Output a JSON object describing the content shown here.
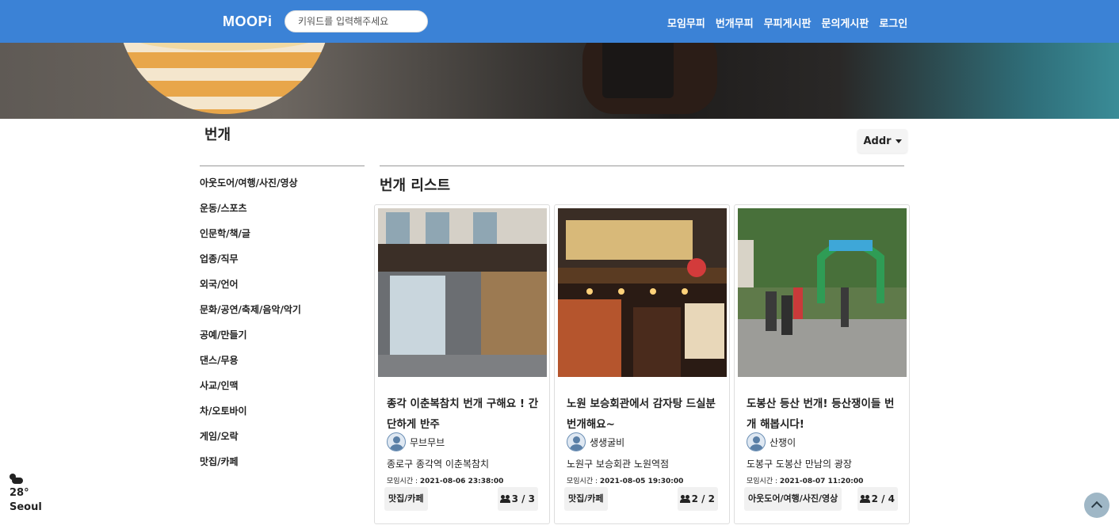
{
  "header": {
    "logo": "MOOPi",
    "search_placeholder": "키워드를 입력해주세요",
    "nav": [
      "모임무피",
      "번개무피",
      "무피게시판",
      "문의게시판",
      "로그인"
    ]
  },
  "page": {
    "title": "번개",
    "addr_button": "Addr",
    "list_title": "번개 리스트"
  },
  "sidebar": {
    "items": [
      "아웃도어/여행/사진/영상",
      "운동/스포츠",
      "인문학/책/글",
      "업종/직무",
      "외국/언어",
      "문화/공연/축제/음악/악기",
      "공예/만들기",
      "댄스/무용",
      "사교/인맥",
      "차/오토바이",
      "게임/오락",
      "맛집/카페"
    ]
  },
  "cards": [
    {
      "title": "종각 이춘복참치 번개 구해요 ! 간단하게 반주",
      "author": "무브무브",
      "place": "종로구 종각역 이춘복참치",
      "time_label": "모임시간 : ",
      "time": "2021-08-06 23:38:00",
      "tag": "맛집/카페",
      "count": "3 / 3"
    },
    {
      "title": "노원 보승회관에서 감자탕 드실분 번개해요~",
      "author": "생생굴비",
      "place": "노원구 보승회관 노원역점",
      "time_label": "모임시간 : ",
      "time": "2021-08-05 19:30:00",
      "tag": "맛집/카페",
      "count": "2 / 2"
    },
    {
      "title": "도봉산 등산 번개! 등산쟁이들 번개 해봅시다!",
      "author": "산쟁이",
      "place": "도봉구 도봉산 만남의 광장",
      "time_label": "모임시간 : ",
      "time": "2021-08-07 11:20:00",
      "tag": "아웃도어/여행/사진/영상",
      "count": "2 / 4"
    }
  ],
  "weather": {
    "icon": "cloud-sun-icon",
    "temp": "28°",
    "city": "Seoul"
  },
  "colors": {
    "header_bg": "#3b82d6",
    "totop_bg": "#9fb7c6"
  }
}
